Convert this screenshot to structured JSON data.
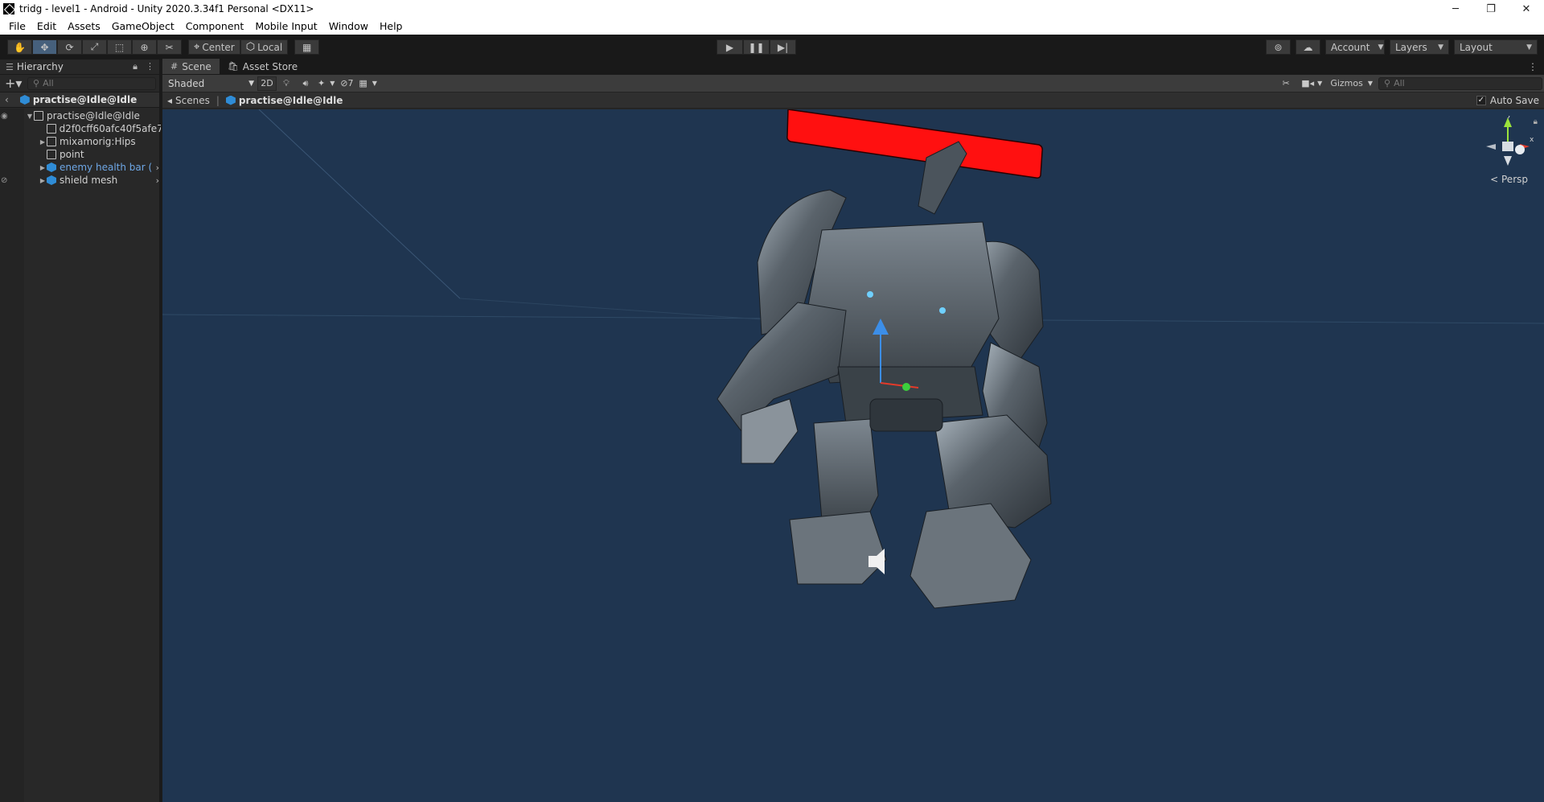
{
  "window": {
    "title": "tridg - level1 - Android - Unity 2020.3.34f1 Personal <DX11>",
    "controls": [
      "─",
      "❐",
      "✕"
    ]
  },
  "menu": [
    "File",
    "Edit",
    "Assets",
    "GameObject",
    "Component",
    "Mobile Input",
    "Window",
    "Help"
  ],
  "toolbar": {
    "pivot_label": "Center",
    "space_label": "Local",
    "account_label": "Account",
    "layers_label": "Layers",
    "layout_label": "Layout"
  },
  "hierarchy": {
    "tab_label": "Hierarchy",
    "search_placeholder": "All",
    "scene_name": "practise@Idle@Idle",
    "items": [
      {
        "label": "practise@Idle@Idle",
        "depth": 0,
        "expanded": true,
        "prefab": false
      },
      {
        "label": "d2f0cff60afc40f5afe7",
        "depth": 1,
        "expanded": false,
        "prefab": false
      },
      {
        "label": "mixamorig:Hips",
        "depth": 1,
        "expanded": false,
        "prefab": false
      },
      {
        "label": "point",
        "depth": 1,
        "expanded": false,
        "prefab": false
      },
      {
        "label": "enemy health bar (",
        "depth": 1,
        "expanded": false,
        "prefab": true
      },
      {
        "label": "shield mesh",
        "depth": 1,
        "expanded": false,
        "prefab": true
      }
    ]
  },
  "scene": {
    "tabs": [
      "Scene",
      "Asset Store"
    ],
    "shading_mode": "Shaded",
    "mode_2d": "2D",
    "hidden_count": "7",
    "gizmos_label": "Gizmos",
    "search_placeholder": "All",
    "breadcrumb_root": "Scenes",
    "breadcrumb_prefab": "practise@Idle@Idle",
    "autosave_label": "Auto Save",
    "autosave_checked": true,
    "projection_label": "Persp",
    "axis_labels": {
      "y": "y",
      "x": "x"
    }
  },
  "colors": {
    "viewport_bg": "#1f3550",
    "health_bar": "#ff1010",
    "prefab_text": "#6ea7e6",
    "accent": "#46607c"
  }
}
